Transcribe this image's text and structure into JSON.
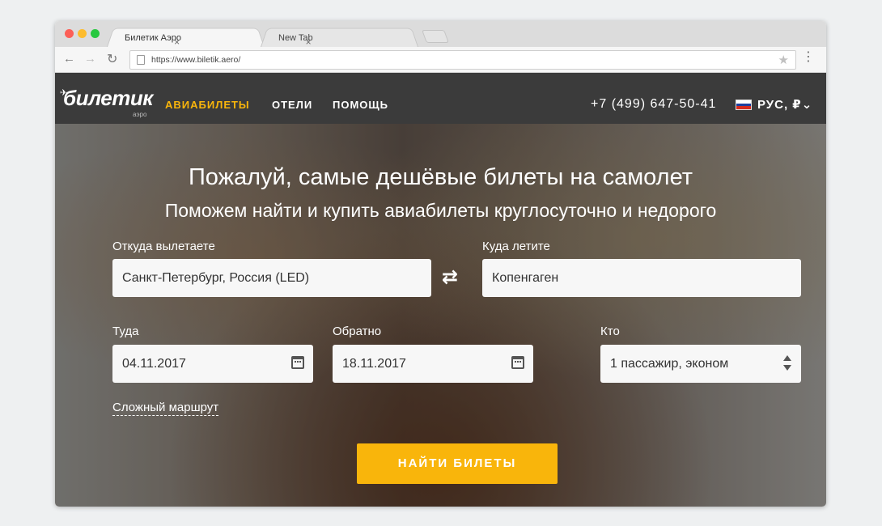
{
  "browser": {
    "tabs": [
      {
        "label": "Билетик Аэро",
        "close": "×"
      },
      {
        "label": "New Tab",
        "close": "×"
      }
    ],
    "url": "https://www.biletik.aero/",
    "icons": {
      "back": "←",
      "forward": "→",
      "reload": "↻",
      "star": "★",
      "menu": "⋮"
    }
  },
  "site": {
    "logo": "билетик",
    "logo_sub": "аэро",
    "logo_plane": "✈",
    "nav": [
      "АВИАБИЛЕТЫ",
      "ОТЕЛИ",
      "ПОМОЩЬ"
    ],
    "phone": "+7 (499) 647-50-41",
    "lang": "РУС, ₽",
    "lang_chevron": "⌄",
    "accent": "#f9b50b"
  },
  "hero": {
    "title": "Пожалуй, самые дешёвые билеты на самолет",
    "subtitle": "Поможем найти и купить авиабилеты круглосуточно и недорого",
    "from_label": "Откуда вылетаете",
    "from_value": "Санкт-Петербург, Россия (LED)",
    "to_label": "Куда летите",
    "to_value": "Копенгаген",
    "swap_icon": "⇄",
    "depart_label": "Туда",
    "depart_value": "04.11.2017",
    "return_label": "Обратно",
    "return_value": "18.11.2017",
    "who_label": "Кто",
    "who_value": "1 пассажир, эконом",
    "complex_route": "Сложный маршрут",
    "search_button": "НАЙТИ БИЛЕТЫ"
  }
}
